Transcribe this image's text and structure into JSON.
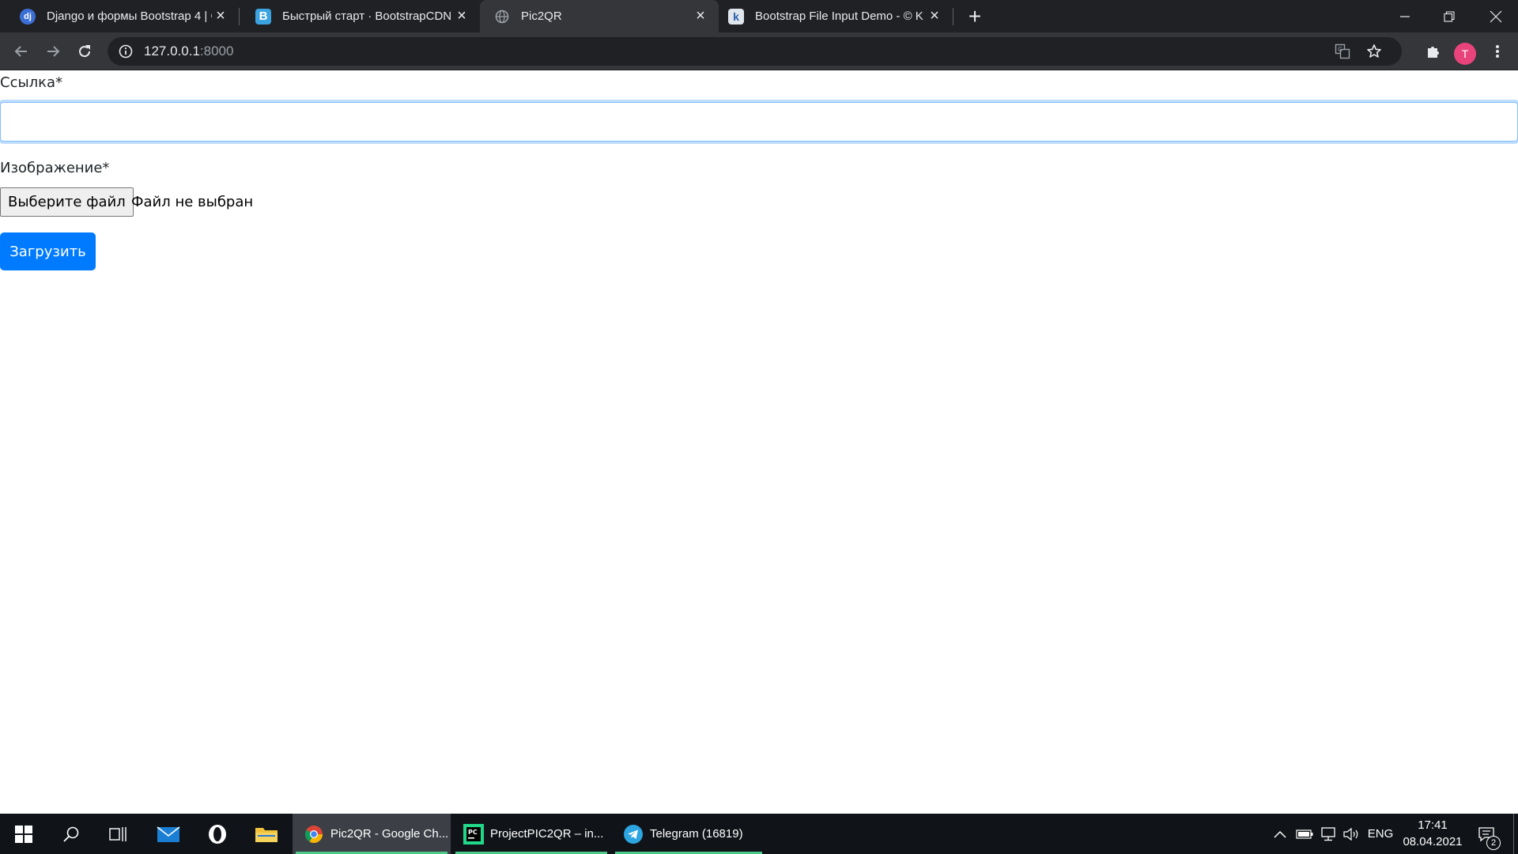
{
  "browser": {
    "tabs": [
      {
        "title": "Django и формы Bootstrap 4 | C",
        "favicon": "dj"
      },
      {
        "title": "Быстрый старт · BootstrapCDN",
        "favicon": "B"
      },
      {
        "title": "Pic2QR",
        "favicon": "globe-icon"
      },
      {
        "title": "Bootstrap File Input Demo - © K",
        "favicon": "k"
      }
    ],
    "active_tab": 2,
    "url_host": "127.0.0.1",
    "url_port": ":8000",
    "profile_initial": "T"
  },
  "form": {
    "link_label": "Ссылка*",
    "link_value": "",
    "image_label": "Изображение*",
    "file_button": "Выберите файл",
    "file_status": "Файл не выбран",
    "submit": "Загрузить"
  },
  "taskbar": {
    "tasks": [
      {
        "label": "Pic2QR - Google Ch...",
        "icon": "chrome-icon"
      },
      {
        "label": "ProjectPIC2QR – in...",
        "icon": "pycharm-icon"
      },
      {
        "label": "Telegram (16819)",
        "icon": "telegram-icon"
      }
    ],
    "language": "ENG",
    "time": "17:41",
    "date": "08.04.2021",
    "notifications": "2"
  },
  "colors": {
    "primary": "#007bff",
    "chrome_dark": "#202124",
    "chrome_toolbar": "#35363a",
    "taskbar": "#101418",
    "profile": "#e8437b"
  }
}
